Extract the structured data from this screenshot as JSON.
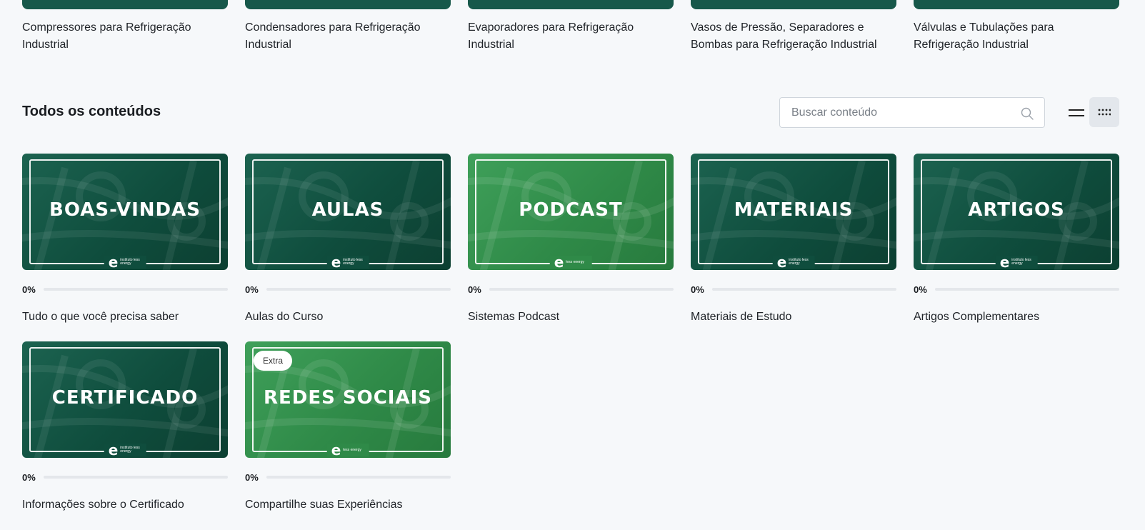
{
  "colors": {
    "background": "#f6f8fa",
    "dark_green": "#0f4d3d",
    "light_green": "#2f8a48",
    "progress_track": "#e4e7eb"
  },
  "top_row": [
    {
      "title": "Compressores para Refrigeração Industrial"
    },
    {
      "title": "Condensadores para Refrigeração Industrial"
    },
    {
      "title": "Evaporadores para Refrigeração Industrial"
    },
    {
      "title": "Vasos de Pressão, Separadores e Bombas para Refrigeração Industrial"
    },
    {
      "title": "Válvulas e Tubulações para Refrigeração Industrial"
    }
  ],
  "section": {
    "title": "Todos os conteúdos",
    "search_placeholder": "Buscar conteúdo",
    "view_list_icon": "list-view-icon",
    "view_grid_icon": "grid-view-icon"
  },
  "cards": [
    {
      "banner": "BOAS-VINDAS",
      "title": "Tudo o que você precisa saber",
      "progress": "0%",
      "progress_value": 0,
      "theme": "dark",
      "logo_words": "instituto less energy",
      "badge": ""
    },
    {
      "banner": "AULAS",
      "title": "Aulas do Curso",
      "progress": "0%",
      "progress_value": 0,
      "theme": "dark",
      "logo_words": "instituto less energy",
      "badge": ""
    },
    {
      "banner": "PODCAST",
      "title": "Sistemas Podcast",
      "progress": "0%",
      "progress_value": 0,
      "theme": "light",
      "logo_words": "less energy",
      "badge": ""
    },
    {
      "banner": "MATERIAIS",
      "title": "Materiais de Estudo",
      "progress": "0%",
      "progress_value": 0,
      "theme": "dark",
      "logo_words": "instituto less energy",
      "badge": ""
    },
    {
      "banner": "ARTIGOS",
      "title": "Artigos Complementares",
      "progress": "0%",
      "progress_value": 0,
      "theme": "dark",
      "logo_words": "instituto less energy",
      "badge": ""
    },
    {
      "banner": "CERTIFICADO",
      "title": "Informações sobre o Certificado",
      "progress": "0%",
      "progress_value": 0,
      "theme": "dark",
      "logo_words": "instituto less energy",
      "badge": ""
    },
    {
      "banner": "REDES SOCIAIS",
      "title": "Compartilhe suas Experiências",
      "progress": "0%",
      "progress_value": 0,
      "theme": "light",
      "logo_words": "less energy",
      "badge": "Extra"
    }
  ]
}
